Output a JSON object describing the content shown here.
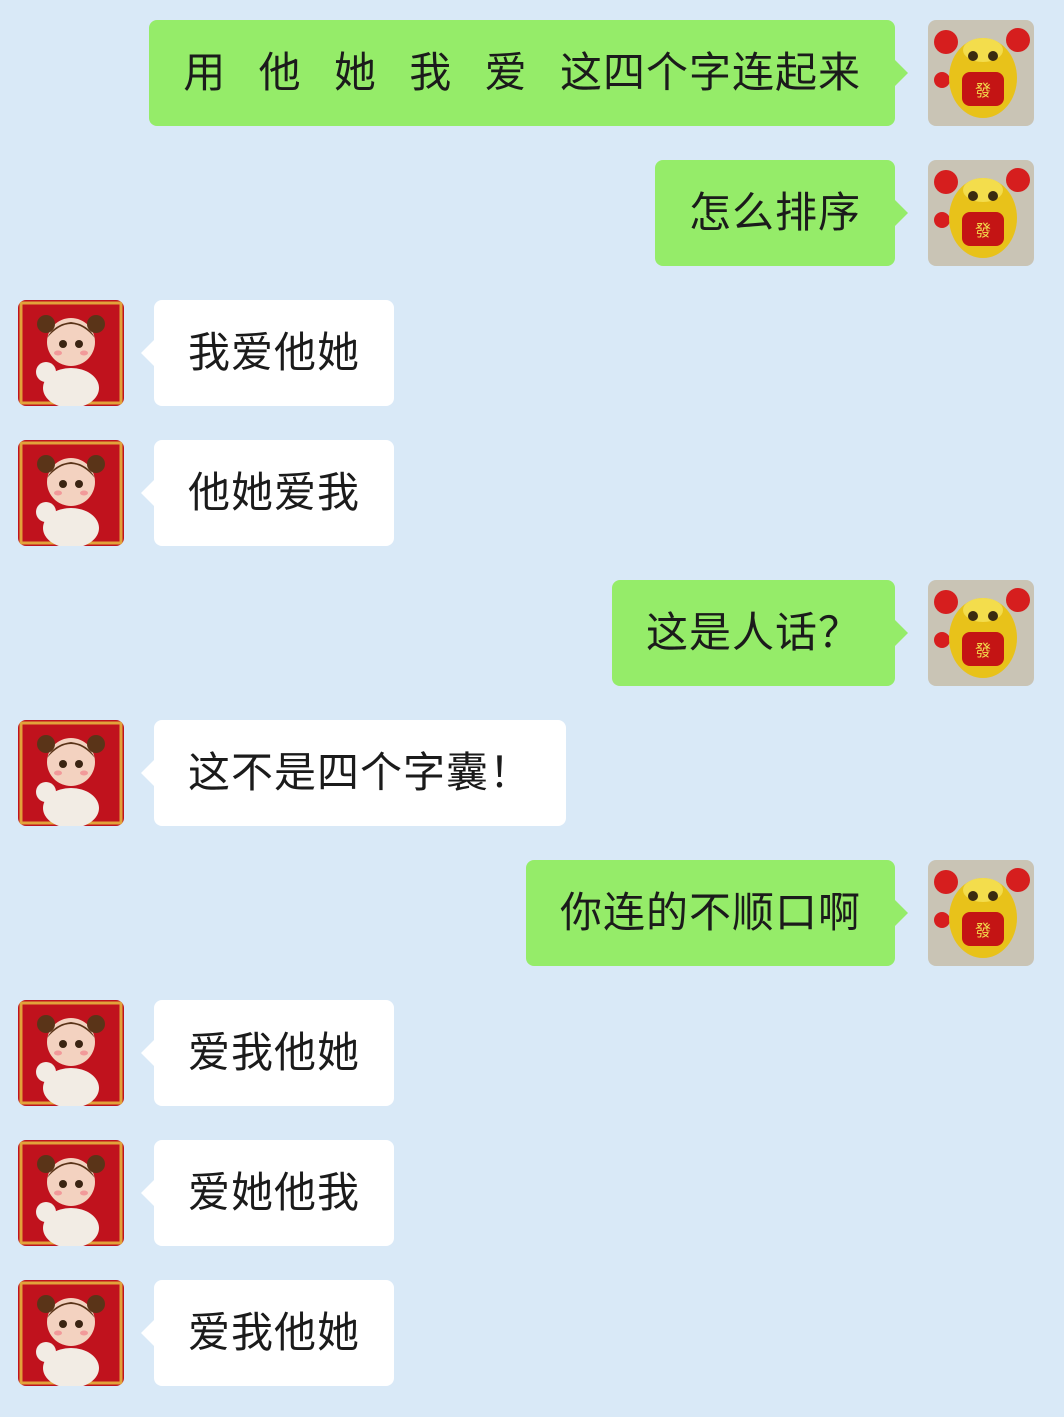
{
  "colors": {
    "background": "#d9e9f7",
    "outgoing_bubble": "#95ec69",
    "incoming_bubble": "#ffffff",
    "text": "#1b1b1b"
  },
  "avatars": {
    "me": "lion-dance-avatar",
    "friend": "girl-cartoon-avatar"
  },
  "messages": [
    {
      "sender": "me",
      "text": "用 他 她 我 爱 这四个字连起来"
    },
    {
      "sender": "me",
      "text": "怎么排序"
    },
    {
      "sender": "friend",
      "text": "我爱他她"
    },
    {
      "sender": "friend",
      "text": "他她爱我"
    },
    {
      "sender": "me",
      "text": "这是人话？"
    },
    {
      "sender": "friend",
      "text": "这不是四个字囊！"
    },
    {
      "sender": "me",
      "text": "你连的不顺口啊"
    },
    {
      "sender": "friend",
      "text": "爱我他她"
    },
    {
      "sender": "friend",
      "text": "爱她他我"
    },
    {
      "sender": "friend",
      "text": "爱我他她"
    }
  ]
}
